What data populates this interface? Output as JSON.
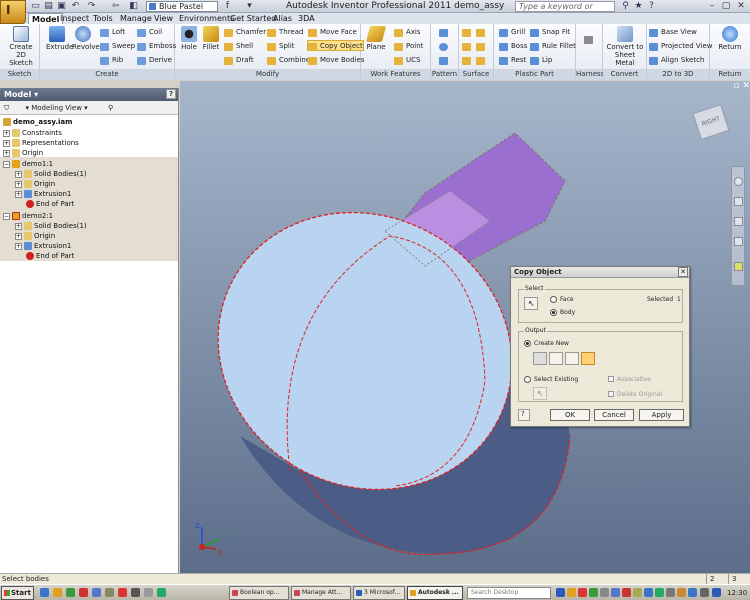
{
  "title_bar": {
    "app_title": "Autodesk Inventor Professional 2011   demo_assy",
    "style_combo": "Blue Pastel",
    "search_placeholder": "Type a keyword or phrase",
    "app_button_label": "I"
  },
  "tabs": [
    "Model",
    "Inspect",
    "Tools",
    "Manage",
    "View",
    "Environments",
    "Get Started",
    "Alias",
    "3DA"
  ],
  "active_tab": "Model",
  "ribbon": {
    "sketch": {
      "label": "Sketch",
      "create_2d_sketch": "Create 2D Sketch"
    },
    "create": {
      "label": "Create",
      "extrude": "Extrude",
      "revolve": "Revolve",
      "loft": "Loft",
      "sweep": "Sweep",
      "rib": "Rib",
      "coil": "Coil",
      "emboss": "Emboss",
      "derive": "Derive"
    },
    "modify": {
      "label": "Modify",
      "hole": "Hole",
      "fillet": "Fillet",
      "chamfer": "Chamfer",
      "shell": "Shell",
      "draft": "Draft",
      "thread": "Thread",
      "split": "Split",
      "combine": "Combine",
      "move_face": "Move Face",
      "copy_object": "Copy Object",
      "move_bodies": "Move Bodies"
    },
    "work_features": {
      "label": "Work Features",
      "plane": "Plane",
      "axis": "Axis",
      "point": "Point",
      "ucs": "UCS"
    },
    "pattern": {
      "label": "Pattern"
    },
    "surface": {
      "label": "Surface"
    },
    "plastic_part": {
      "label": "Plastic Part",
      "grill": "Grill",
      "boss": "Boss",
      "rest": "Rest",
      "snap_fit": "Snap Fit",
      "rule_fillet": "Rule Fillet",
      "lip": "Lip"
    },
    "harness": {
      "label": "Harness"
    },
    "convert": {
      "label": "Convert",
      "convert_sheet_metal": "Convert to Sheet Metal"
    },
    "two_d_to_3d": {
      "label": "2D to 3D",
      "base_view": "Base View",
      "projected_view": "Projected View",
      "align_sketch": "Align Sketch"
    },
    "return": {
      "label": "Return",
      "return_btn": "Return"
    }
  },
  "browser": {
    "title": "Model",
    "view_label": "Modeling View",
    "items": [
      {
        "label": "demo_assy.iam"
      },
      {
        "label": "Constraints"
      },
      {
        "label": "Representations"
      },
      {
        "label": "Origin"
      },
      {
        "label": "demo1:1"
      },
      {
        "label": "Solid Bodies(1)"
      },
      {
        "label": "Origin"
      },
      {
        "label": "Extrusion1"
      },
      {
        "label": "End of Part"
      },
      {
        "label": "demo2:1"
      },
      {
        "label": "Solid Bodies(1)"
      },
      {
        "label": "Origin"
      },
      {
        "label": "Extrusion1"
      },
      {
        "label": "End of Part"
      }
    ]
  },
  "viewport": {
    "viewcube_label": "RIGHT",
    "axis_z": "Z",
    "axis_x": "X",
    "axis_y": "Y"
  },
  "dialog": {
    "title": "Copy Object",
    "select_group": "Select",
    "face_label": "Face",
    "body_label": "Body",
    "selected_label": "Selected",
    "selected_count": "1",
    "output_group": "Output",
    "create_new_label": "Create New",
    "select_existing_label": "Select Existing",
    "associative_label": "Associative",
    "delete_original_label": "Delete Original",
    "ok_label": "OK",
    "cancel_label": "Cancel",
    "apply_label": "Apply"
  },
  "status": {
    "text": "Select bodies",
    "cell1": "2",
    "cell2": "3"
  },
  "taskbar": {
    "start": "Start",
    "tasks": [
      "Boolean op...",
      "Manage Att...",
      "3 Microsof...",
      "Autodesk ..."
    ],
    "search_placeholder": "Search Desktop",
    "clock": "12:30"
  },
  "colors": {
    "viewport_top": "#a7b6cb",
    "viewport_bottom": "#5b6d89",
    "selection_red": "#e02020",
    "highlight_body": "#b8d4f0",
    "purple_box": "#9a6fd0"
  }
}
